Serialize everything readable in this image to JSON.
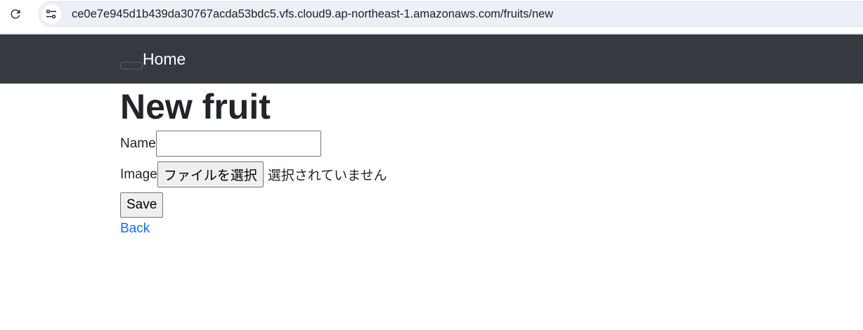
{
  "browser": {
    "url": "ce0e7e945d1b439da30767acda53bdc5.vfs.cloud9.ap-northeast-1.amazonaws.com/fruits/new",
    "reload_icon": "reload-icon",
    "site_info_icon": "site-settings-icon"
  },
  "navbar": {
    "brand": "Home",
    "background": "#343a40"
  },
  "page": {
    "title": "New fruit"
  },
  "form": {
    "name_label": "Name",
    "name_value": "",
    "image_label": "Image",
    "file_button_label": "ファイルを選択",
    "file_status": "選択されていません",
    "save_label": "Save"
  },
  "links": {
    "back": "Back",
    "link_color": "#0d6efd"
  }
}
